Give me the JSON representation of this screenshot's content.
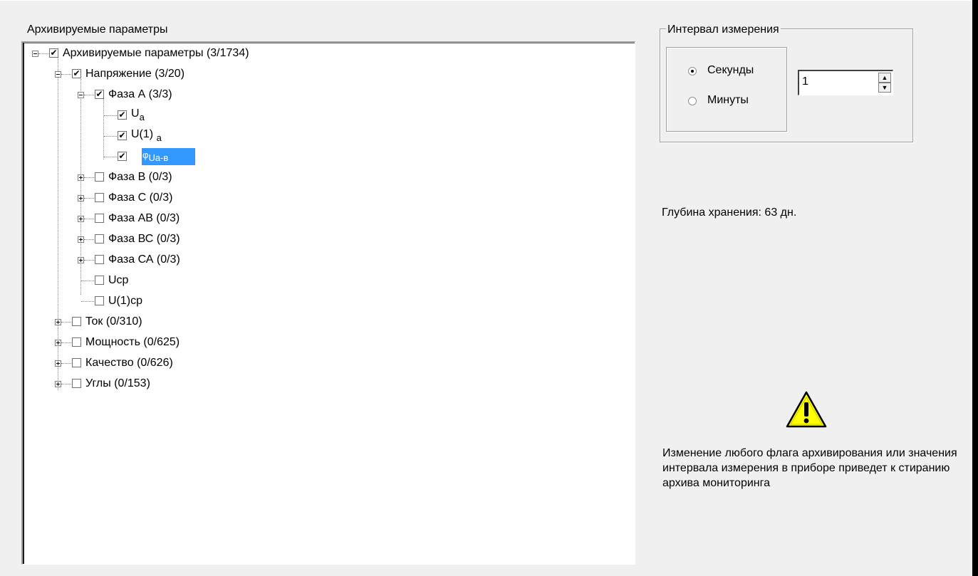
{
  "tree_label": "Архивируемые параметры",
  "tree": {
    "root": "Архивируемые параметры (3/1734)",
    "voltage": "Напряжение (3/20)",
    "phase_a": "Фаза А (3/3)",
    "ua_main": "U",
    "ua_sub": "a",
    "u1a_main": "U(1)",
    "u1a_sub": "a",
    "phi_main": "φ",
    "phi_sub": "Ua-в",
    "phase_b": "Фаза В (0/3)",
    "phase_c": "Фаза С (0/3)",
    "phase_ab": "Фаза АВ (0/3)",
    "phase_bc": "Фаза ВС (0/3)",
    "phase_ca": "Фаза СА (0/3)",
    "ucp": "Uср",
    "u1cp": "U(1)ср",
    "current": "Ток (0/310)",
    "power": "Мощность (0/625)",
    "quality": "Качество (0/626)",
    "angles": "Углы (0/153)"
  },
  "interval": {
    "title": "Интервал измерения",
    "seconds_label": "Секунды",
    "minutes_label": "Минуты",
    "selected": "seconds",
    "value": "1"
  },
  "storage_depth": "Глубина хранения: 63 дн.",
  "warning_icon": "warning-triangle-icon",
  "warning_text": "Изменение любого флага архивирования или значения интервала измерения в приборе приведет к стиранию архива мониторинга",
  "colors": {
    "selection": "#3399ff",
    "warning_fill": "#ffff00"
  }
}
